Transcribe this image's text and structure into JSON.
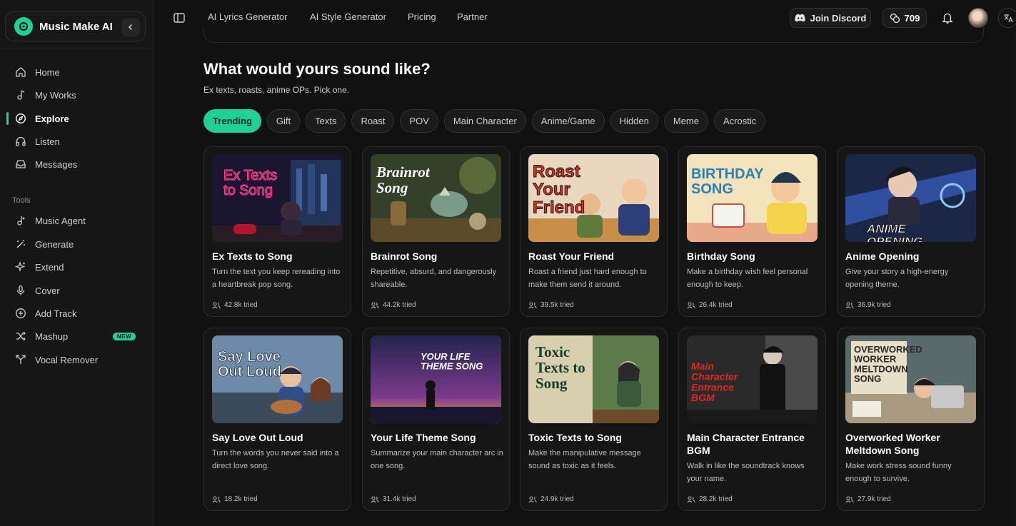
{
  "brand": {
    "name": "Music Make AI"
  },
  "sidebar": {
    "main_items": [
      {
        "label": "Home",
        "icon": "home-icon"
      },
      {
        "label": "My Works",
        "icon": "music-note-icon"
      },
      {
        "label": "Explore",
        "icon": "compass-icon",
        "active": true
      },
      {
        "label": "Listen",
        "icon": "headphones-icon"
      },
      {
        "label": "Messages",
        "icon": "inbox-icon"
      }
    ],
    "tools_label": "Tools",
    "tool_items": [
      {
        "label": "Music Agent",
        "icon": "agent-icon"
      },
      {
        "label": "Generate",
        "icon": "magic-wand-icon"
      },
      {
        "label": "Extend",
        "icon": "sparkle-icon"
      },
      {
        "label": "Cover",
        "icon": "microphone-icon"
      },
      {
        "label": "Add Track",
        "icon": "plus-circle-icon"
      },
      {
        "label": "Mashup",
        "icon": "shuffle-icon",
        "badge": "NEW"
      },
      {
        "label": "Vocal Remover",
        "icon": "split-icon"
      }
    ]
  },
  "topbar": {
    "links": [
      "AI Lyrics Generator",
      "AI Style Generator",
      "Pricing",
      "Partner"
    ],
    "discord_label": "Join Discord",
    "credits": "709"
  },
  "main": {
    "headline": "What would yours sound like?",
    "subline": "Ex texts, roasts, anime OPs. Pick one.",
    "tabs": [
      "Trending",
      "Gift",
      "Texts",
      "Roast",
      "POV",
      "Main Character",
      "Anime/Game",
      "Hidden",
      "Meme",
      "Acrostic"
    ],
    "active_tab": "Trending",
    "cards": [
      {
        "title": "Ex Texts to Song",
        "desc": "Turn the text you keep rereading into a heartbreak pop song.",
        "tried": "42.8k tried",
        "thumb_text": "Ex Texts to Song"
      },
      {
        "title": "Brainrot Song",
        "desc": "Repetitive, absurd, and dangerously shareable.",
        "tried": "44.2k tried",
        "thumb_text": "Brainrot Song"
      },
      {
        "title": "Roast Your Friend",
        "desc": "Roast a friend just hard enough to make them send it around.",
        "tried": "39.5k tried",
        "thumb_text": "Roast Your Friend"
      },
      {
        "title": "Birthday Song",
        "desc": "Make a birthday wish feel personal enough to keep.",
        "tried": "26.4k tried",
        "thumb_text": "BIRTHDAY SONG"
      },
      {
        "title": "Anime Opening",
        "desc": "Give your story a high-energy opening theme.",
        "tried": "36.9k tried",
        "thumb_text": "ANIME OPENING"
      },
      {
        "title": "Say Love Out Loud",
        "desc": "Turn the words you never said into a direct love song.",
        "tried": "18.2k tried",
        "thumb_text": "Say Love Out Loud"
      },
      {
        "title": "Your Life Theme Song",
        "desc": "Summarize your main character arc in one song.",
        "tried": "31.4k tried",
        "thumb_text": "YOUR LIFE THEME SONG"
      },
      {
        "title": "Toxic Texts to Song",
        "desc": "Make the manipulative message sound as toxic as it feels.",
        "tried": "24.9k tried",
        "thumb_text": "Toxic Texts to Song"
      },
      {
        "title": "Main Character Entrance BGM",
        "desc": "Walk in like the soundtrack knows your name.",
        "tried": "28.2k tried",
        "thumb_text": "Main Character Entrance BGM"
      },
      {
        "title": "Overworked Worker Meltdown Song",
        "desc": "Make work stress sound funny enough to survive.",
        "tried": "27.9k tried",
        "thumb_text": "OVERWORKED WORKER MELTDOWN SONG"
      }
    ]
  },
  "colors": {
    "accent": "#1fd197",
    "background": "#111111",
    "card": "#161616"
  }
}
